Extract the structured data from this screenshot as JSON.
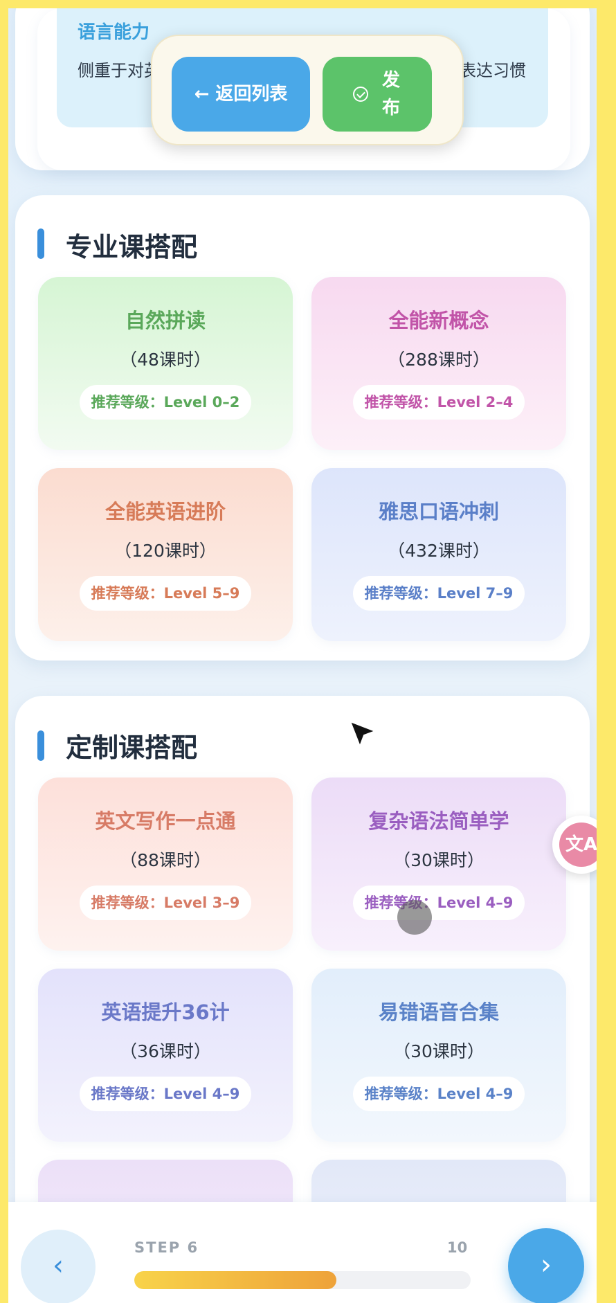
{
  "top": {
    "lang_title": "语言能力",
    "lang_desc": "侧重于对英语语言知识的系统学习和理解，提升母语表达习惯"
  },
  "toolbar": {
    "back_label": "← 返回列表",
    "publish_label": "发布"
  },
  "professional": {
    "title": "专业课搭配",
    "courses": [
      {
        "name": "自然拼读",
        "hours": "（48课时）",
        "level": "推荐等级：Level 0–2",
        "color": "#5aa85a"
      },
      {
        "name": "全能新概念",
        "hours": "（288课时）",
        "level": "推荐等级：Level 2–4",
        "color": "#c154a8"
      },
      {
        "name": "全能英语进阶",
        "hours": "（120课时）",
        "level": "推荐等级：Level 5–9",
        "color": "#d77b58"
      },
      {
        "name": "雅思口语冲刺",
        "hours": "（432课时）",
        "level": "推荐等级：Level 7–9",
        "color": "#5a7fc8"
      }
    ]
  },
  "custom": {
    "title": "定制课搭配",
    "courses": [
      {
        "name": "英文写作一点通",
        "hours": "（88课时）",
        "level": "推荐等级：Level 3–9",
        "color": "#d77b66"
      },
      {
        "name": "复杂语法简单学",
        "hours": "（30课时）",
        "level": "推荐等级：Level 4–9",
        "color": "#9a5ec0"
      },
      {
        "name": "英语提升36计",
        "hours": "（36课时）",
        "level": "推荐等级：Level 4–9",
        "color": "#6a78c8"
      },
      {
        "name": "易错语音合集",
        "hours": "（30课时）",
        "level": "推荐等级：Level 4–9",
        "color": "#5a82c8"
      }
    ]
  },
  "bottom_nav": {
    "step_label": "STEP 6",
    "step_total": "10",
    "progress": 0.6,
    "prev_icon": "chevron-left-icon",
    "next_icon": "chevron-right-icon"
  },
  "floating": {
    "translate_icon": "translate-icon"
  }
}
